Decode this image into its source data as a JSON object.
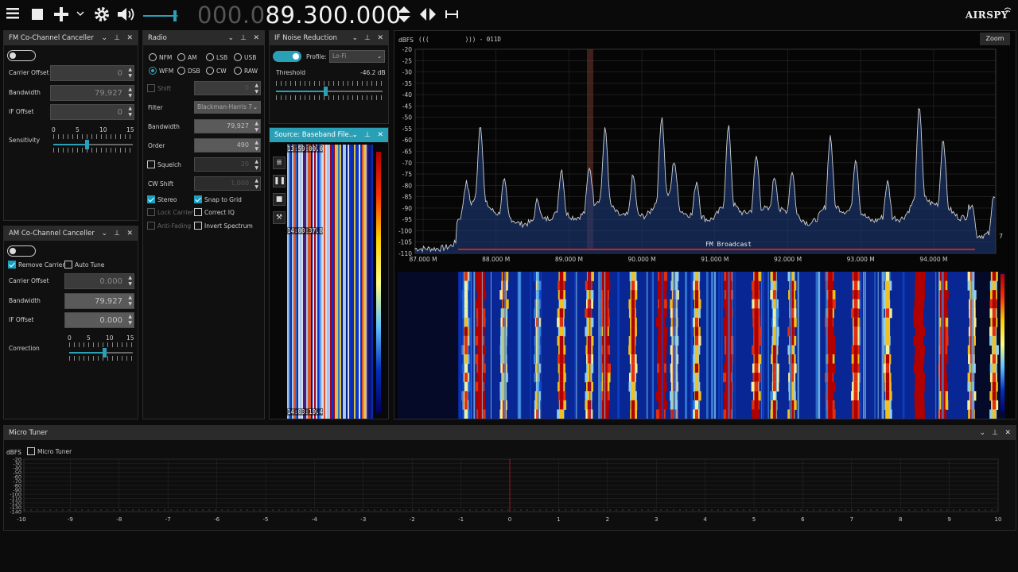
{
  "toolbar": {
    "freq_dim": "000.0",
    "freq_main": "89.300.000",
    "logo": "AIRSPY"
  },
  "fm_cc": {
    "title": "FM Co-Channel Canceller",
    "carrier_offset_label": "Carrier Offset",
    "carrier_offset": "0",
    "bandwidth_label": "Bandwidth",
    "bandwidth": "79,927",
    "if_offset_label": "IF Offset",
    "if_offset": "0",
    "sensitivity_label": "Sensitivity",
    "scale": [
      "0",
      "5",
      "10",
      "15"
    ]
  },
  "am_cc": {
    "title": "AM Co-Channel Canceller",
    "remove_carrier": "Remove Carrier",
    "auto_tune": "Auto Tune",
    "carrier_offset_label": "Carrier Offset",
    "carrier_offset": "0.000",
    "bandwidth_label": "Bandwidth",
    "bandwidth": "79,927",
    "if_offset_label": "IF Offset",
    "if_offset": "0.000",
    "correction_label": "Correction",
    "scale": [
      "0",
      "5",
      "10",
      "15"
    ]
  },
  "radio": {
    "title": "Radio",
    "modes": [
      "NFM",
      "AM",
      "LSB",
      "USB",
      "WFM",
      "DSB",
      "CW",
      "RAW"
    ],
    "selected_mode": "WFM",
    "shift_label": "Shift",
    "shift": "0",
    "filter_label": "Filter",
    "filter": "Blackman-Harris 7",
    "bandwidth_label": "Bandwidth",
    "bandwidth": "79,927",
    "order_label": "Order",
    "order": "490",
    "squelch_label": "Squelch",
    "squelch": "20",
    "cw_shift_label": "CW Shift",
    "cw_shift": "1,000",
    "stereo": "Stereo",
    "snap": "Snap to Grid",
    "lock_carrier": "Lock Carrier",
    "correct_iq": "Correct IQ",
    "anti_fading": "Anti-Fading",
    "invert_spectrum": "Invert Spectrum"
  },
  "if_nr": {
    "title": "IF Noise Reduction",
    "profile_label": "Profile:",
    "profile": "Lo-Fi",
    "threshold_label": "Threshold",
    "threshold": "-46.2 dB"
  },
  "source": {
    "title": "Source: Baseband File...",
    "times": [
      "13:59:00.0",
      "14:00:37.8",
      "14:03:19.4"
    ]
  },
  "spectrum": {
    "dbfs": "dBFS",
    "rds": "(((          ))) - 011D",
    "zoom": "Zoom",
    "y_ticks": [
      "-20",
      "-25",
      "-30",
      "-35",
      "-40",
      "-45",
      "-50",
      "-55",
      "-60",
      "-65",
      "-70",
      "-75",
      "-80",
      "-85",
      "-90",
      "-95",
      "-100",
      "-105",
      "-110"
    ],
    "x_ticks": [
      "87.000 M",
      "88.000 M",
      "89.000 M",
      "90.000 M",
      "91.000 M",
      "92.000 M",
      "93.000 M",
      "94.000 M"
    ],
    "band_label": "FM Broadcast",
    "edge_marker": "7"
  },
  "micro": {
    "title": "Micro Tuner",
    "dbfs": "dBFS",
    "check_label": "Micro Tuner",
    "y_ticks": [
      "-20",
      "-30",
      "-40",
      "-50",
      "-60",
      "-70",
      "-80",
      "-90",
      "-100",
      "-110",
      "-120",
      "-130",
      "-140"
    ],
    "x_ticks": [
      "-10",
      "-9",
      "-8",
      "-7",
      "-6",
      "-5",
      "-4",
      "-3",
      "-2",
      "-1",
      "0",
      "1",
      "2",
      "3",
      "4",
      "5",
      "6",
      "7",
      "8",
      "9",
      "10"
    ]
  },
  "colors": {
    "accent": "#2aa0b6",
    "background": "#0c0c0c",
    "panel_header": "#2b2b2b"
  }
}
